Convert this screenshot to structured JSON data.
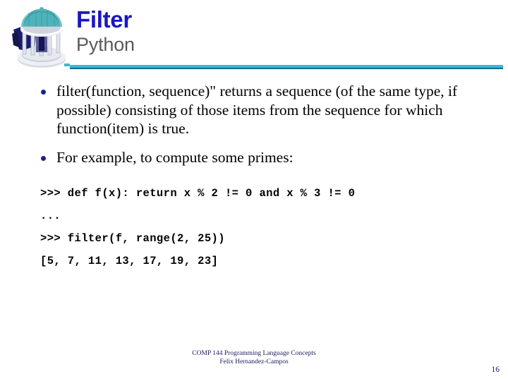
{
  "header": {
    "title": "Filter",
    "subtitle": "Python",
    "logo_name": "unc-old-well-logo",
    "title_color": "#1a16c2",
    "subtitle_color": "#5a5a5a",
    "rule_color_top": "#38b8dd",
    "rule_color_bottom": "#0d6f8c"
  },
  "body": {
    "bullets": [
      {
        "text": "filter(function, sequence)\" returns a sequence (of the same type, if possible) consisting of those items from the sequence for which function(item) is true."
      },
      {
        "text": "For example, to compute some primes:"
      }
    ],
    "bullet_color": "#1f1f8f"
  },
  "code": {
    "lines": [
      ">>> def f(x): return x % 2 != 0 and x % 3 != 0",
      "...",
      ">>> filter(f, range(2, 25))",
      "[5, 7, 11, 13, 17, 19, 23]"
    ]
  },
  "footer": {
    "line1": "COMP 144 Programming Language Concepts",
    "line2": "Felix Hernandez-Campos",
    "page_number": "16",
    "color": "#1a1a5e"
  }
}
